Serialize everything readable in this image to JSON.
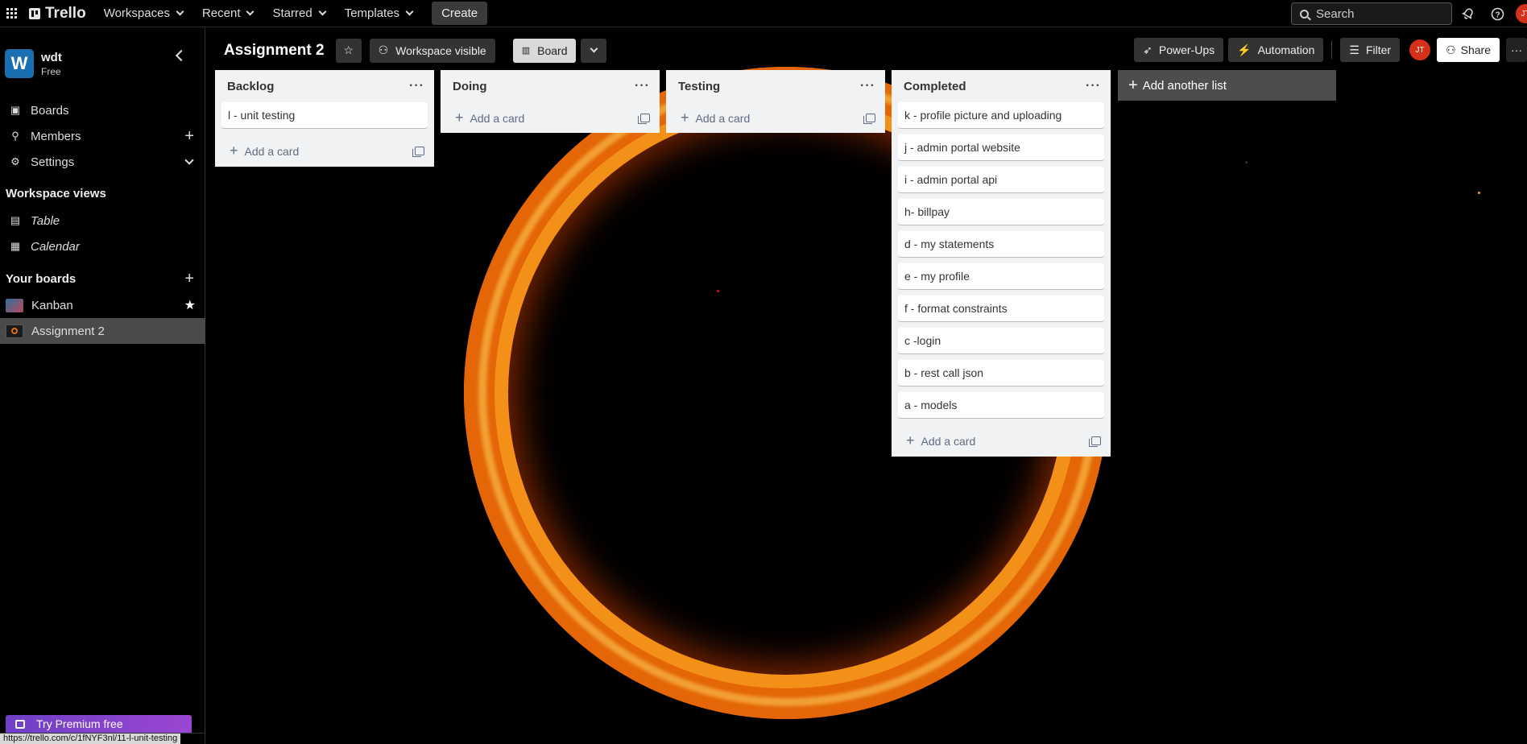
{
  "topbar": {
    "logo": "Trello",
    "nav": [
      "Workspaces",
      "Recent",
      "Starred",
      "Templates"
    ],
    "create": "Create",
    "search_placeholder": "Search",
    "avatar": "JT"
  },
  "sidebar": {
    "workspace_initial": "W",
    "workspace_name": "wdt",
    "workspace_plan": "Free",
    "items": [
      {
        "label": "Boards",
        "icon": "trello-board-icon"
      },
      {
        "label": "Members",
        "icon": "person-icon"
      },
      {
        "label": "Settings",
        "icon": "gear-icon"
      }
    ],
    "views_heading": "Workspace views",
    "views": [
      {
        "label": "Table",
        "icon": "table-icon"
      },
      {
        "label": "Calendar",
        "icon": "calendar-icon"
      }
    ],
    "boards_heading": "Your boards",
    "boards": [
      {
        "label": "Kanban",
        "color": "#2c6f9e"
      },
      {
        "label": "Assignment 2",
        "color": "#c85a10"
      }
    ],
    "premium": "Try Premium free",
    "status_url": "https://trello.com/c/1fNYF3nl/11-l-unit-testing"
  },
  "board": {
    "title": "Assignment 2",
    "visibility": "Workspace visible",
    "view": "Board",
    "powerups": "Power-Ups",
    "automation": "Automation",
    "filter": "Filter",
    "share": "Share",
    "avatar": "JT"
  },
  "lists": [
    {
      "title": "Backlog",
      "cards": [
        "l - unit testing"
      ],
      "add": "Add a card"
    },
    {
      "title": "Doing",
      "cards": [],
      "add": "Add a card"
    },
    {
      "title": "Testing",
      "cards": [],
      "add": "Add a card"
    },
    {
      "title": "Completed",
      "cards": [
        "k - profile picture and uploading",
        "j - admin portal website",
        "i - admin portal api",
        "h- billpay",
        "d - my statements",
        "e - my profile",
        "f - format constraints",
        "c -login",
        "b - rest call json",
        "a - models"
      ],
      "add": "Add a card"
    }
  ],
  "add_list": "Add another list",
  "colors": {
    "accent": "#1a6fb0",
    "premium": "#7a40cc",
    "avatar": "#d4301a",
    "fire": "#f39017"
  }
}
